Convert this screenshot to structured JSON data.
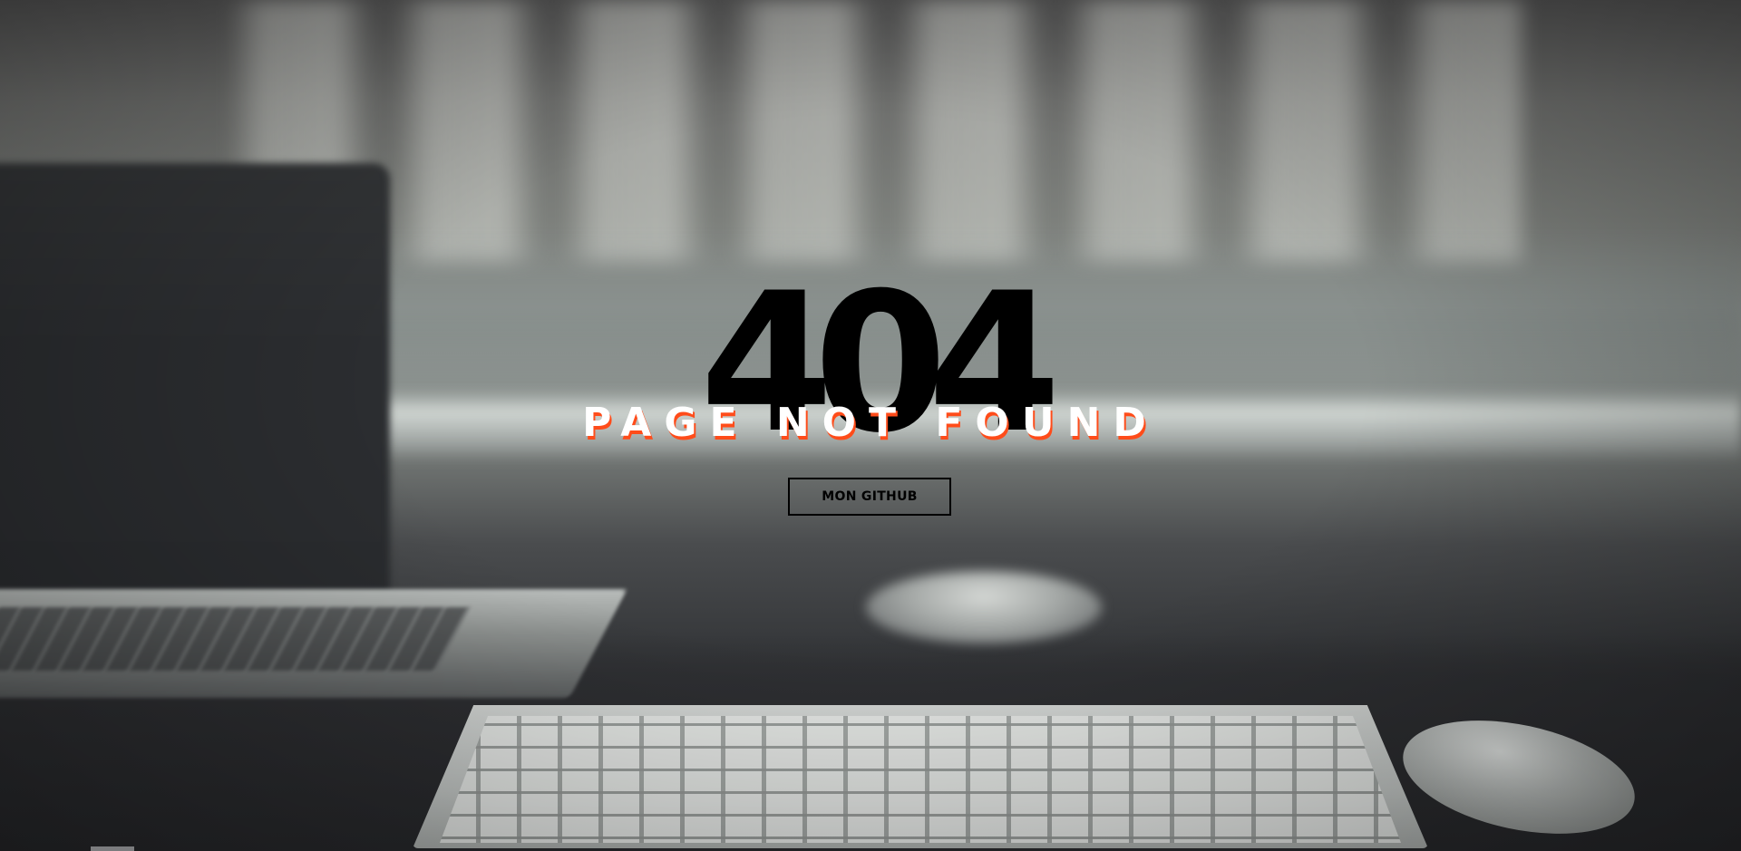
{
  "error": {
    "code": "404",
    "headline": "PAGE NOT FOUND",
    "button_label": "MON GITHUB"
  },
  "colors": {
    "code_color": "#000000",
    "headline_color": "#ffffff",
    "headline_shadow": "#ff4c1a",
    "button_border": "#000000"
  },
  "background": {
    "description_icon": "desk-photo"
  }
}
